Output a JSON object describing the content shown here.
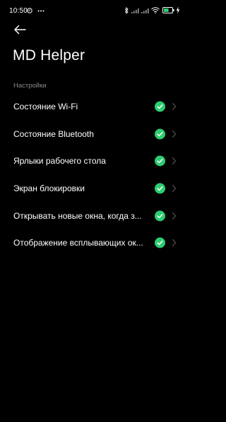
{
  "status_bar": {
    "time": "10:50",
    "icons": [
      "sync-icon",
      "more-dots-icon",
      "bluetooth-icon",
      "signal-icon",
      "signal-icon",
      "wifi-icon",
      "battery-icon",
      "charging-icon"
    ],
    "battery_level": 0.6,
    "accent_color": "#2ecc71"
  },
  "header": {
    "back_icon": "arrow-left-icon",
    "title": "MD Helper"
  },
  "section": {
    "title": "Настройки"
  },
  "settings": [
    {
      "label": "Состояние Wi-Fi",
      "enabled": true
    },
    {
      "label": "Состояние Bluetooth",
      "enabled": true
    },
    {
      "label": "Ярлыки рабочего стола",
      "enabled": true
    },
    {
      "label": "Экран блокировки",
      "enabled": true
    },
    {
      "label": "Открывать новые окна, когда з...",
      "enabled": true
    },
    {
      "label": "Отображение всплывающих ок...",
      "enabled": true
    }
  ],
  "colors": {
    "background": "#000000",
    "check": "#2ecc71",
    "secondary_text": "#8a8a8a",
    "chevron": "#555555"
  }
}
